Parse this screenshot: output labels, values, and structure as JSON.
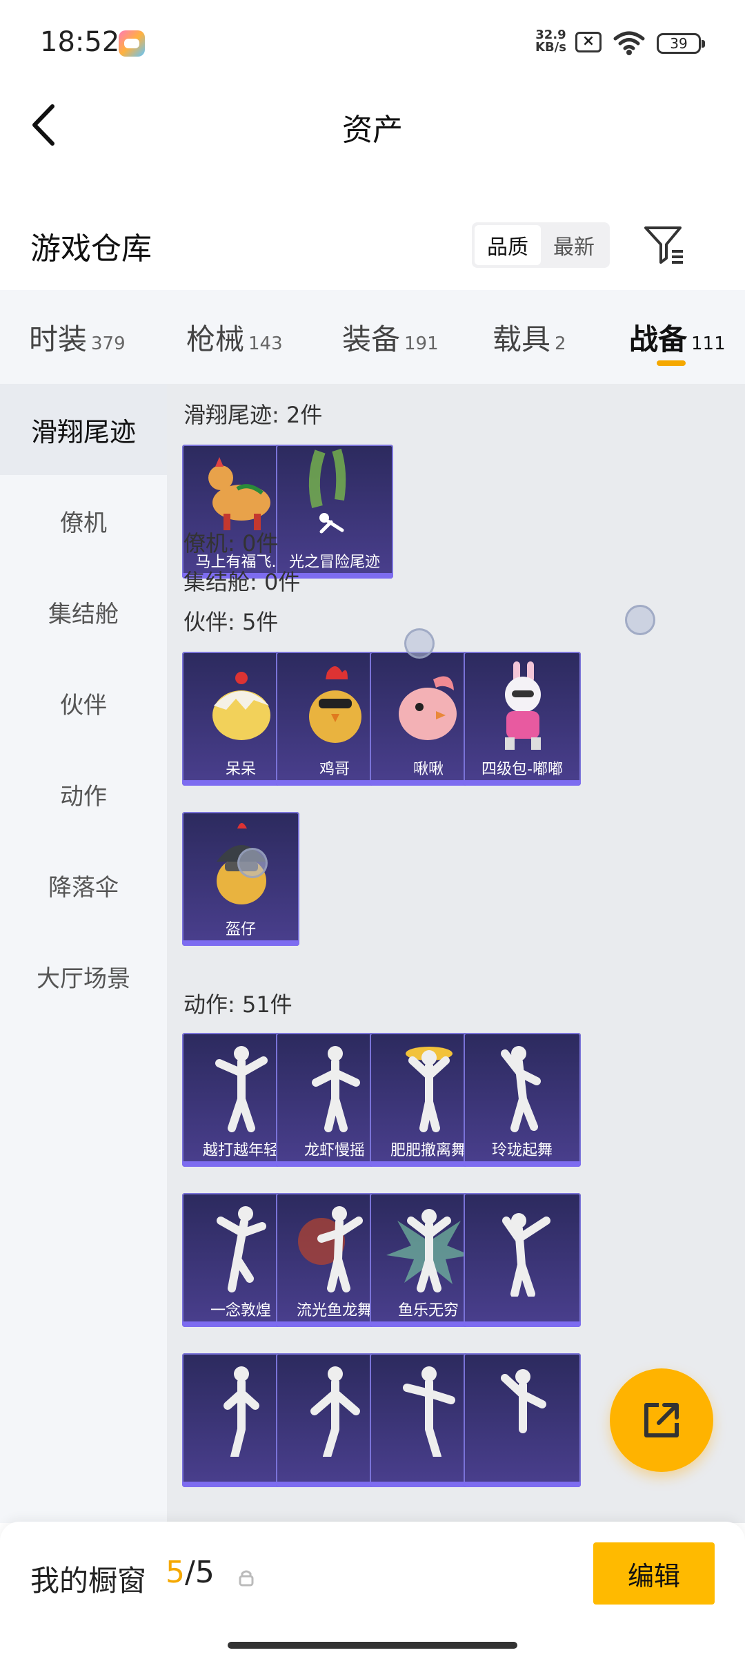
{
  "status_bar": {
    "time": "18:52",
    "net_speed_value": "32.9",
    "net_speed_unit": "KB/s",
    "battery": "39",
    "app_badge_icon": "game-controller-icon"
  },
  "header": {
    "back_icon": "back-arrow-icon",
    "title": "资产"
  },
  "warehouse": {
    "title": "游戏仓库",
    "sort_options": [
      "品质",
      "最新"
    ],
    "sort_selected": "品质",
    "filter_icon": "filter-icon"
  },
  "tabs": [
    {
      "label": "时装",
      "count": "379"
    },
    {
      "label": "枪械",
      "count": "143"
    },
    {
      "label": "装备",
      "count": "191"
    },
    {
      "label": "载具",
      "count": "2"
    },
    {
      "label": "战备",
      "count": "111"
    }
  ],
  "active_tab": "战备",
  "side_nav": [
    "滑翔尾迹",
    "僚机",
    "集结舱",
    "伙伴",
    "动作",
    "降落伞",
    "大厅场景"
  ],
  "side_nav_active": "滑翔尾迹",
  "groups": {
    "glide": {
      "heading": "滑翔尾迹: 2件",
      "items": [
        "马上有福飞...",
        "光之冒险尾迹"
      ]
    },
    "wingman": {
      "heading": "僚机: 0件"
    },
    "assembly": {
      "heading": "集结舱: 0件"
    },
    "partner": {
      "heading": "伙伴: 5件",
      "items": [
        "呆呆",
        "鸡哥",
        "啾啾",
        "四级包-嘟嘟",
        "盔仔"
      ]
    },
    "emote": {
      "heading": "动作: 51件",
      "items": [
        "越打越年轻",
        "龙虾慢摇",
        "肥肥撤离舞",
        "玲珑起舞",
        "一念敦煌",
        "流光鱼龙舞",
        "鱼乐无穷",
        "",
        "",
        "",
        "",
        ""
      ]
    }
  },
  "bottom_bar": {
    "showcase_label": "我的橱窗",
    "current": "5",
    "slash": "/",
    "total": "5",
    "lock_icon": "lock-icon",
    "edit_label": "编辑"
  },
  "fab_icon": "share-external-icon",
  "colors": {
    "accent": "#ffba00",
    "card_bg": "#3b3576",
    "card_border": "#7a73d8",
    "page_bg": "#f4f6f9"
  }
}
